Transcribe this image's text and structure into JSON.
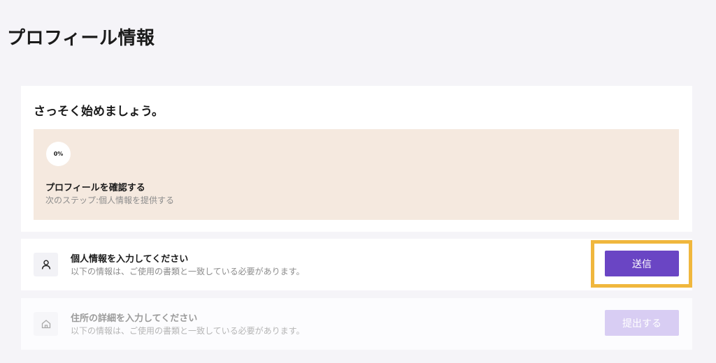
{
  "page": {
    "title": "プロフィール情報"
  },
  "intro": {
    "heading": "さっそく始めましょう。",
    "progress": {
      "percent_label": "0%",
      "percent_value": 0,
      "title": "プロフィールを確認する",
      "next_step": "次のステップ:個人情報を提供する"
    }
  },
  "steps": [
    {
      "icon": "person-icon",
      "title": "個人情報を入力してください",
      "description": "以下の情報は、ご使用の書類と一致している必要があります。",
      "button_label": "送信",
      "enabled": true
    },
    {
      "icon": "home-icon",
      "title": "住所の詳細を入力してください",
      "description": "以下の情報は、ご使用の書類と一致している必要があります。",
      "button_label": "提出する",
      "enabled": false
    }
  ],
  "colors": {
    "accent": "#6a45c4",
    "accent_disabled": "#d8cdf3",
    "highlight": "#f0b73d",
    "progress_panel": "#f5e9df",
    "background": "#f5f4f8"
  }
}
